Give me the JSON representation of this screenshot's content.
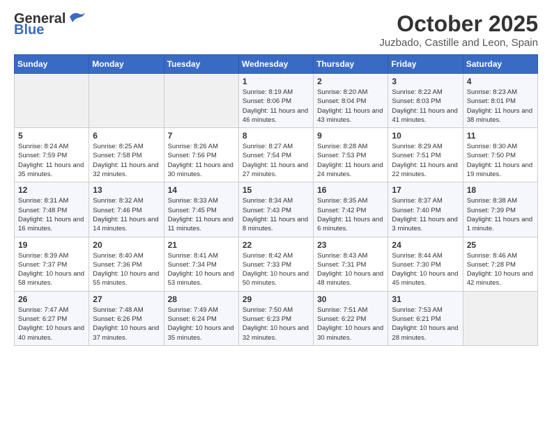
{
  "logo": {
    "general": "General",
    "blue": "Blue"
  },
  "title": "October 2025",
  "subtitle": "Juzbado, Castille and Leon, Spain",
  "days_of_week": [
    "Sunday",
    "Monday",
    "Tuesday",
    "Wednesday",
    "Thursday",
    "Friday",
    "Saturday"
  ],
  "weeks": [
    [
      {
        "day": "",
        "sunrise": "",
        "sunset": "",
        "daylight": ""
      },
      {
        "day": "",
        "sunrise": "",
        "sunset": "",
        "daylight": ""
      },
      {
        "day": "",
        "sunrise": "",
        "sunset": "",
        "daylight": ""
      },
      {
        "day": "1",
        "sunrise": "Sunrise: 8:19 AM",
        "sunset": "Sunset: 8:06 PM",
        "daylight": "Daylight: 11 hours and 46 minutes."
      },
      {
        "day": "2",
        "sunrise": "Sunrise: 8:20 AM",
        "sunset": "Sunset: 8:04 PM",
        "daylight": "Daylight: 11 hours and 43 minutes."
      },
      {
        "day": "3",
        "sunrise": "Sunrise: 8:22 AM",
        "sunset": "Sunset: 8:03 PM",
        "daylight": "Daylight: 11 hours and 41 minutes."
      },
      {
        "day": "4",
        "sunrise": "Sunrise: 8:23 AM",
        "sunset": "Sunset: 8:01 PM",
        "daylight": "Daylight: 11 hours and 38 minutes."
      }
    ],
    [
      {
        "day": "5",
        "sunrise": "Sunrise: 8:24 AM",
        "sunset": "Sunset: 7:59 PM",
        "daylight": "Daylight: 11 hours and 35 minutes."
      },
      {
        "day": "6",
        "sunrise": "Sunrise: 8:25 AM",
        "sunset": "Sunset: 7:58 PM",
        "daylight": "Daylight: 11 hours and 32 minutes."
      },
      {
        "day": "7",
        "sunrise": "Sunrise: 8:26 AM",
        "sunset": "Sunset: 7:56 PM",
        "daylight": "Daylight: 11 hours and 30 minutes."
      },
      {
        "day": "8",
        "sunrise": "Sunrise: 8:27 AM",
        "sunset": "Sunset: 7:54 PM",
        "daylight": "Daylight: 11 hours and 27 minutes."
      },
      {
        "day": "9",
        "sunrise": "Sunrise: 8:28 AM",
        "sunset": "Sunset: 7:53 PM",
        "daylight": "Daylight: 11 hours and 24 minutes."
      },
      {
        "day": "10",
        "sunrise": "Sunrise: 8:29 AM",
        "sunset": "Sunset: 7:51 PM",
        "daylight": "Daylight: 11 hours and 22 minutes."
      },
      {
        "day": "11",
        "sunrise": "Sunrise: 8:30 AM",
        "sunset": "Sunset: 7:50 PM",
        "daylight": "Daylight: 11 hours and 19 minutes."
      }
    ],
    [
      {
        "day": "12",
        "sunrise": "Sunrise: 8:31 AM",
        "sunset": "Sunset: 7:48 PM",
        "daylight": "Daylight: 11 hours and 16 minutes."
      },
      {
        "day": "13",
        "sunrise": "Sunrise: 8:32 AM",
        "sunset": "Sunset: 7:46 PM",
        "daylight": "Daylight: 11 hours and 14 minutes."
      },
      {
        "day": "14",
        "sunrise": "Sunrise: 8:33 AM",
        "sunset": "Sunset: 7:45 PM",
        "daylight": "Daylight: 11 hours and 11 minutes."
      },
      {
        "day": "15",
        "sunrise": "Sunrise: 8:34 AM",
        "sunset": "Sunset: 7:43 PM",
        "daylight": "Daylight: 11 hours and 8 minutes."
      },
      {
        "day": "16",
        "sunrise": "Sunrise: 8:35 AM",
        "sunset": "Sunset: 7:42 PM",
        "daylight": "Daylight: 11 hours and 6 minutes."
      },
      {
        "day": "17",
        "sunrise": "Sunrise: 8:37 AM",
        "sunset": "Sunset: 7:40 PM",
        "daylight": "Daylight: 11 hours and 3 minutes."
      },
      {
        "day": "18",
        "sunrise": "Sunrise: 8:38 AM",
        "sunset": "Sunset: 7:39 PM",
        "daylight": "Daylight: 11 hours and 1 minute."
      }
    ],
    [
      {
        "day": "19",
        "sunrise": "Sunrise: 8:39 AM",
        "sunset": "Sunset: 7:37 PM",
        "daylight": "Daylight: 10 hours and 58 minutes."
      },
      {
        "day": "20",
        "sunrise": "Sunrise: 8:40 AM",
        "sunset": "Sunset: 7:36 PM",
        "daylight": "Daylight: 10 hours and 55 minutes."
      },
      {
        "day": "21",
        "sunrise": "Sunrise: 8:41 AM",
        "sunset": "Sunset: 7:34 PM",
        "daylight": "Daylight: 10 hours and 53 minutes."
      },
      {
        "day": "22",
        "sunrise": "Sunrise: 8:42 AM",
        "sunset": "Sunset: 7:33 PM",
        "daylight": "Daylight: 10 hours and 50 minutes."
      },
      {
        "day": "23",
        "sunrise": "Sunrise: 8:43 AM",
        "sunset": "Sunset: 7:31 PM",
        "daylight": "Daylight: 10 hours and 48 minutes."
      },
      {
        "day": "24",
        "sunrise": "Sunrise: 8:44 AM",
        "sunset": "Sunset: 7:30 PM",
        "daylight": "Daylight: 10 hours and 45 minutes."
      },
      {
        "day": "25",
        "sunrise": "Sunrise: 8:46 AM",
        "sunset": "Sunset: 7:28 PM",
        "daylight": "Daylight: 10 hours and 42 minutes."
      }
    ],
    [
      {
        "day": "26",
        "sunrise": "Sunrise: 7:47 AM",
        "sunset": "Sunset: 6:27 PM",
        "daylight": "Daylight: 10 hours and 40 minutes."
      },
      {
        "day": "27",
        "sunrise": "Sunrise: 7:48 AM",
        "sunset": "Sunset: 6:26 PM",
        "daylight": "Daylight: 10 hours and 37 minutes."
      },
      {
        "day": "28",
        "sunrise": "Sunrise: 7:49 AM",
        "sunset": "Sunset: 6:24 PM",
        "daylight": "Daylight: 10 hours and 35 minutes."
      },
      {
        "day": "29",
        "sunrise": "Sunrise: 7:50 AM",
        "sunset": "Sunset: 6:23 PM",
        "daylight": "Daylight: 10 hours and 32 minutes."
      },
      {
        "day": "30",
        "sunrise": "Sunrise: 7:51 AM",
        "sunset": "Sunset: 6:22 PM",
        "daylight": "Daylight: 10 hours and 30 minutes."
      },
      {
        "day": "31",
        "sunrise": "Sunrise: 7:53 AM",
        "sunset": "Sunset: 6:21 PM",
        "daylight": "Daylight: 10 hours and 28 minutes."
      },
      {
        "day": "",
        "sunrise": "",
        "sunset": "",
        "daylight": ""
      }
    ]
  ]
}
